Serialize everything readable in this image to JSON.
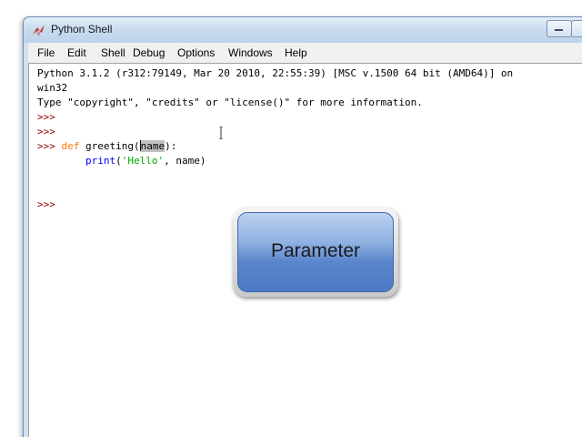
{
  "window": {
    "title": "Python Shell"
  },
  "menubar": {
    "items": [
      "File",
      "Edit",
      "Shell",
      "Debug",
      "Options",
      "Windows",
      "Help"
    ]
  },
  "shell": {
    "banner_1": "Python 3.1.2 (r312:79149, Mar 20 2010, 22:55:39) [MSC v.1500 64 bit (AMD64)] on",
    "banner_2": "win32",
    "banner_3": "Type \"copyright\", \"credits\" or \"license()\" for more information.",
    "prompt": ">>>",
    "def_keyword": "def",
    "def_name": "greeting",
    "paren_open": "(",
    "param": "name",
    "paren_close": "):",
    "body_indent": "    ",
    "body_func": "print",
    "body_open": "(",
    "body_str": "'Hello'",
    "body_rest": ", name)"
  },
  "overlay": {
    "label": "Parameter"
  },
  "colors": {
    "prompt": "#8b0000",
    "keyword": "#ff7700",
    "builtin": "#0000ff",
    "string": "#00aa00",
    "callout_fill": "#5b86cd"
  }
}
